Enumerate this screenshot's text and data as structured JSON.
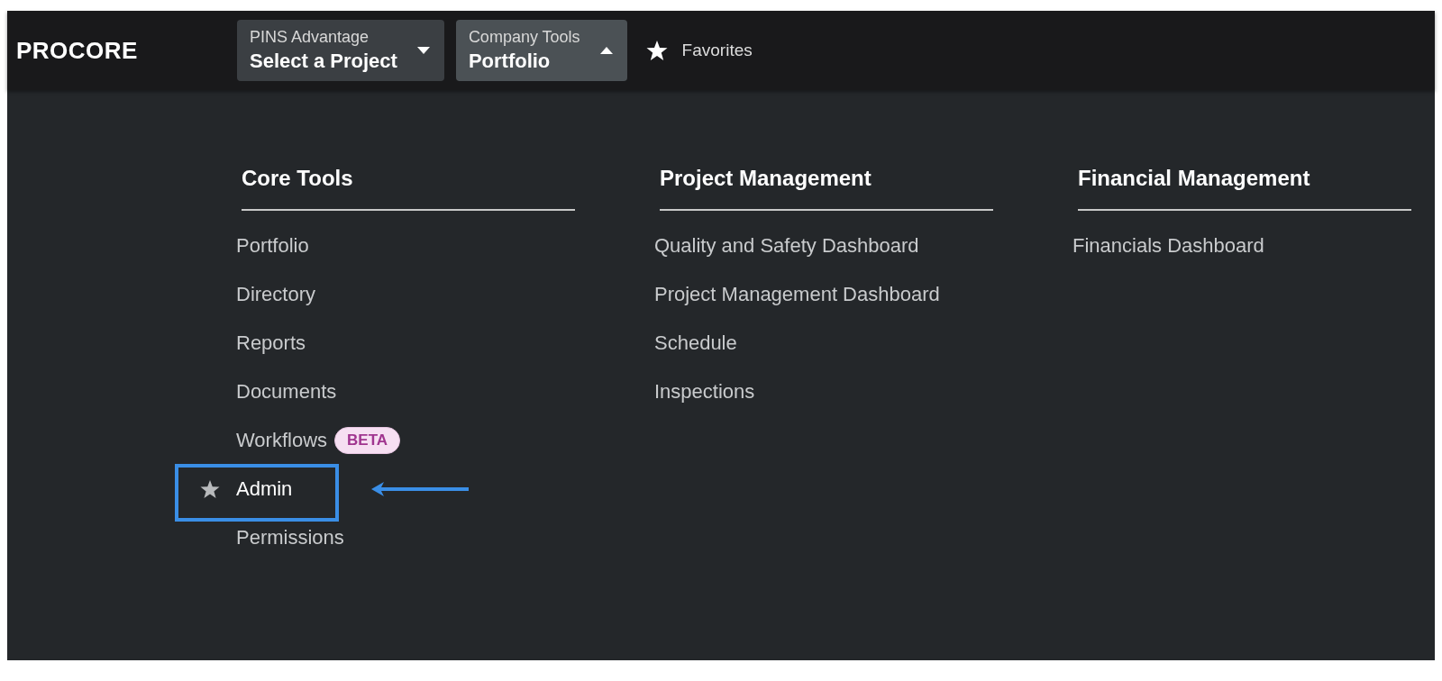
{
  "header": {
    "logo": "PROCORE",
    "dropdowns": [
      {
        "label": "PINS Advantage",
        "value": "Select a Project",
        "expanded": false
      },
      {
        "label": "Company Tools",
        "value": "Portfolio",
        "expanded": true
      }
    ],
    "favorites": "Favorites"
  },
  "columns": [
    {
      "title": "Core Tools",
      "items": [
        {
          "label": "Portfolio",
          "hovered": false,
          "annotated": false
        },
        {
          "label": "Directory",
          "hovered": false,
          "annotated": false
        },
        {
          "label": "Reports",
          "hovered": false,
          "annotated": false
        },
        {
          "label": "Documents",
          "hovered": false,
          "annotated": false
        },
        {
          "label": "Workflows",
          "badge": "BETA",
          "hovered": false,
          "annotated": false
        },
        {
          "label": "Admin",
          "hovered": true,
          "annotated": true
        },
        {
          "label": "Permissions",
          "hovered": false,
          "annotated": false
        }
      ]
    },
    {
      "title": "Project Management",
      "items": [
        {
          "label": "Quality and Safety Dashboard",
          "hovered": false,
          "annotated": false
        },
        {
          "label": "Project Management Dashboard",
          "hovered": false,
          "annotated": false
        },
        {
          "label": "Schedule",
          "hovered": false,
          "annotated": false
        },
        {
          "label": "Inspections",
          "hovered": false,
          "annotated": false
        }
      ]
    },
    {
      "title": "Financial Management",
      "items": [
        {
          "label": "Financials Dashboard",
          "hovered": false,
          "annotated": false
        }
      ]
    }
  ]
}
